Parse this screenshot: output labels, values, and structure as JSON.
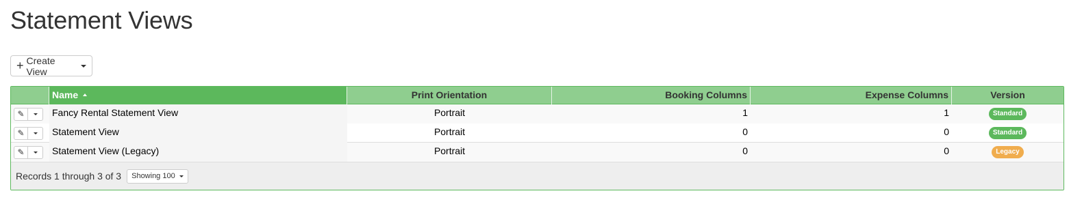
{
  "page": {
    "title": "Statement Views"
  },
  "toolbar": {
    "create_label": "Create View"
  },
  "table": {
    "columns": {
      "name": "Name",
      "orientation": "Print Orientation",
      "booking": "Booking Columns",
      "expense": "Expense Columns",
      "version": "Version"
    },
    "rows": [
      {
        "name": "Fancy Rental Statement View",
        "orientation": "Portrait",
        "booking": "1",
        "expense": "1",
        "version": "Standard"
      },
      {
        "name": "Statement View",
        "orientation": "Portrait",
        "booking": "0",
        "expense": "0",
        "version": "Standard"
      },
      {
        "name": "Statement View (Legacy)",
        "orientation": "Portrait",
        "booking": "0",
        "expense": "0",
        "version": "Legacy"
      }
    ]
  },
  "footer": {
    "records_text": "Records 1 through 3 of 3",
    "showing_label": "Showing 100"
  },
  "colors": {
    "grid_border": "#5cb85c",
    "header_bg": "#8fce8f",
    "badge_standard": "#5cb85c",
    "badge_legacy": "#f0ad4e"
  }
}
